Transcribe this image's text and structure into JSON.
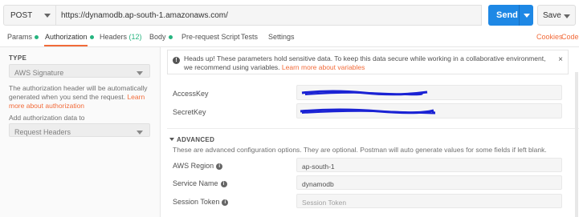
{
  "request": {
    "method": "POST",
    "url": "https://dynamodb.ap-south-1.amazonaws.com/",
    "send_label": "Send",
    "save_label": "Save"
  },
  "tabs": [
    {
      "label": "Params"
    },
    {
      "label": "Authorization"
    },
    {
      "label": "Headers",
      "count": "(12)"
    },
    {
      "label": "Body"
    },
    {
      "label": "Pre-request Script"
    },
    {
      "label": "Tests"
    },
    {
      "label": "Settings"
    }
  ],
  "right_links": {
    "cookies": "Cookies",
    "code": "Code"
  },
  "auth": {
    "type_heading": "TYPE",
    "type_value": "AWS Signature",
    "help_text": "The authorization header will be automatically generated when you send the request.",
    "help_link": "Learn more about authorization",
    "add_to_label": "Add authorization data to",
    "add_to_value": "Request Headers"
  },
  "notice": {
    "text": "Heads up! These parameters hold sensitive data. To keep this data secure while working in a collaborative environment, we recommend using variables.",
    "link": "Learn more about variables",
    "close": "×"
  },
  "fields": {
    "access_key_label": "AccessKey",
    "secret_key_label": "SecretKey"
  },
  "advanced": {
    "heading": "ADVANCED",
    "description": "These are advanced configuration options. They are optional. Postman will auto generate values for some fields if left blank.",
    "region_label": "AWS Region",
    "region_value": "ap-south-1",
    "service_label": "Service Name",
    "service_value": "dynamodb",
    "token_label": "Session Token",
    "token_placeholder": "Session Token"
  },
  "colors": {
    "accent": "#f26b3a",
    "primary": "#1e88e5",
    "status_green": "#26b47f",
    "redaction": "#1a22d4"
  }
}
